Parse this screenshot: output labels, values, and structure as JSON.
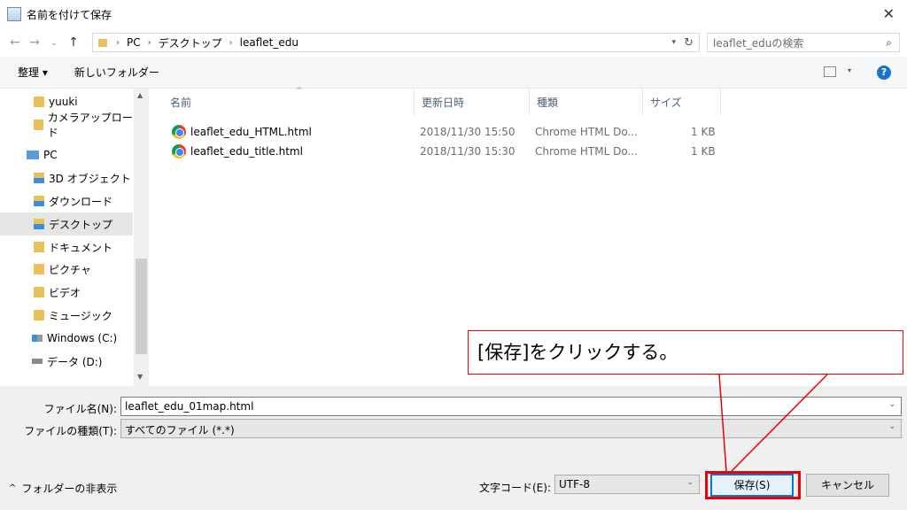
{
  "window": {
    "title": "名前を付けて保存",
    "close": "✕"
  },
  "nav": {
    "back": "←",
    "forward": "→",
    "recent": "⌄",
    "up": "↑",
    "breadcrumbs": [
      "PC",
      "デスクトップ",
      "leaflet_edu"
    ],
    "search_placeholder": "leaflet_eduの検索"
  },
  "toolbar": {
    "organize": "整理 ▾",
    "new_folder": "新しいフォルダー",
    "help": "?"
  },
  "sidebar": {
    "items": [
      {
        "label": "yuuki",
        "icon": "folder-icon"
      },
      {
        "label": "カメラアップロード",
        "icon": "folder-icon"
      },
      {
        "label": "PC",
        "icon": "pc-icon"
      },
      {
        "label": "3D オブジェクト",
        "icon": "folder-icon"
      },
      {
        "label": "ダウンロード",
        "icon": "download-folder-icon"
      },
      {
        "label": "デスクトップ",
        "icon": "desktop-folder-icon"
      },
      {
        "label": "ドキュメント",
        "icon": "documents-folder-icon"
      },
      {
        "label": "ピクチャ",
        "icon": "pictures-folder-icon"
      },
      {
        "label": "ビデオ",
        "icon": "videos-folder-icon"
      },
      {
        "label": "ミュージック",
        "icon": "music-folder-icon"
      },
      {
        "label": "Windows (C:)",
        "icon": "drive-icon"
      },
      {
        "label": "データ (D:)",
        "icon": "drive-icon"
      }
    ],
    "selected": "デスクトップ"
  },
  "files": {
    "columns": [
      "名前",
      "更新日時",
      "種類",
      "サイズ"
    ],
    "rows": [
      {
        "name": "leaflet_edu_HTML.html",
        "modified": "2018/11/30 15:50",
        "type": "Chrome HTML Do...",
        "size": "1 KB"
      },
      {
        "name": "leaflet_edu_title.html",
        "modified": "2018/11/30 15:30",
        "type": "Chrome HTML Do...",
        "size": "1 KB"
      }
    ]
  },
  "form": {
    "filename_label": "ファイル名(N):",
    "filename_value": "leaflet_edu_01map.html",
    "filetype_label": "ファイルの種類(T):",
    "filetype_value": "すべてのファイル  (*.*)",
    "encoding_label": "文字コード(E):",
    "encoding_value": "UTF-8"
  },
  "footer": {
    "hide_folders": "フォルダーの非表示",
    "save": "保存(S)",
    "cancel": "キャンセル"
  },
  "annotation": {
    "text": "[保存]をクリックする。",
    "color": "#e00000"
  }
}
